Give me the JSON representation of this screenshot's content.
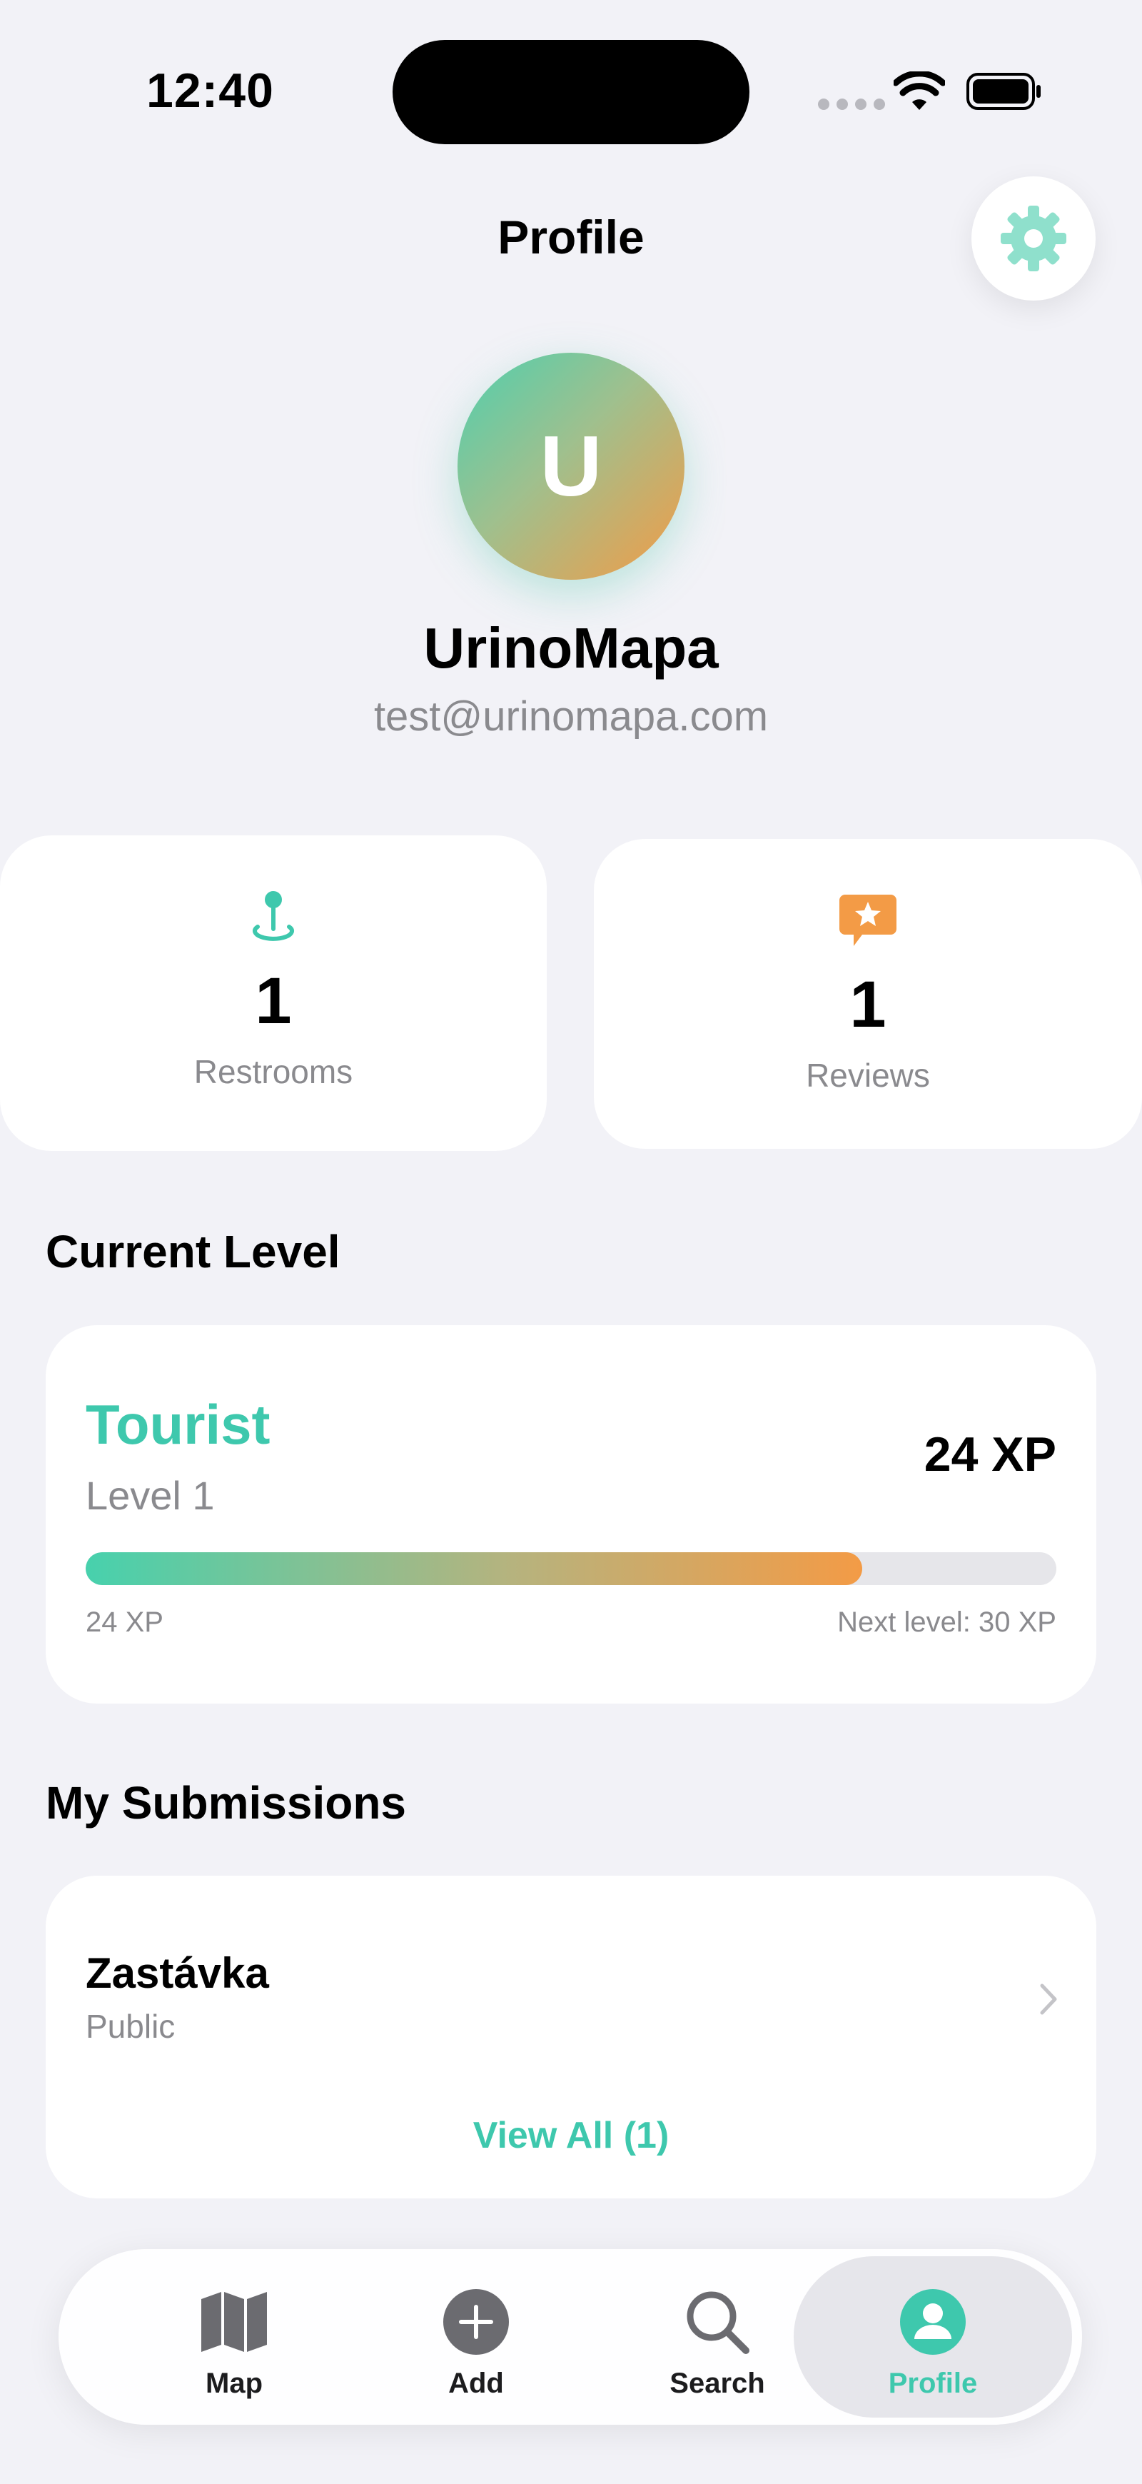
{
  "status_bar": {
    "time": "12:40"
  },
  "header": {
    "title": "Profile"
  },
  "profile": {
    "initial": "U",
    "name": "UrinoMapa",
    "email": "test@urinomapa.com"
  },
  "stats": {
    "restrooms": {
      "value": "1",
      "label": "Restrooms",
      "icon": "map-pin-icon"
    },
    "reviews": {
      "value": "1",
      "label": "Reviews",
      "icon": "star-bubble-icon"
    }
  },
  "level": {
    "section_title": "Current Level",
    "name": "Tourist",
    "level_label": "Level 1",
    "xp_label": "24 XP",
    "current_xp_label": "24 XP",
    "next_level_label": "Next level: 30 XP",
    "progress_fraction": 0.8
  },
  "submissions": {
    "section_title": "My Submissions",
    "items": [
      {
        "name": "Zastávka",
        "status": "Public"
      }
    ],
    "view_all_label": "View All (1)"
  },
  "tabbar": {
    "tabs": [
      {
        "label": "Map",
        "icon": "map-icon"
      },
      {
        "label": "Add",
        "icon": "add-icon"
      },
      {
        "label": "Search",
        "icon": "search-icon"
      },
      {
        "label": "Profile",
        "icon": "person-icon",
        "active": true
      }
    ]
  },
  "colors": {
    "accent": "#3ec8ad",
    "orange": "#f39b46",
    "background": "#f2f2f7"
  }
}
